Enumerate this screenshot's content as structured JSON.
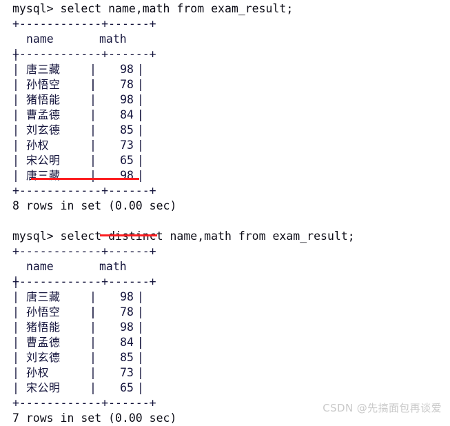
{
  "terminal": {
    "prompt": "mysql> ",
    "blocks": [
      {
        "id": "query-1",
        "command": "mysql> select name,math from exam_result;",
        "separator": "+------------+------+",
        "headers": {
          "name": "name",
          "math": "math"
        },
        "rows": [
          {
            "name": "唐三藏",
            "math": "98"
          },
          {
            "name": "孙悟空",
            "math": "78"
          },
          {
            "name": "猪悟能",
            "math": "98"
          },
          {
            "name": "曹孟德",
            "math": "84"
          },
          {
            "name": "刘玄德",
            "math": "85"
          },
          {
            "name": "孙权",
            "math": "73"
          },
          {
            "name": "宋公明",
            "math": "65"
          },
          {
            "name": "唐三藏",
            "math": "98"
          }
        ],
        "result": "8 rows in set (0.00 sec)"
      },
      {
        "id": "query-2",
        "command": "mysql> select distinct name,math from exam_result;",
        "separator": "+------------+------+",
        "headers": {
          "name": "name",
          "math": "math"
        },
        "rows": [
          {
            "name": "唐三藏",
            "math": "98"
          },
          {
            "name": "孙悟空",
            "math": "78"
          },
          {
            "name": "猪悟能",
            "math": "98"
          },
          {
            "name": "曹孟德",
            "math": "84"
          },
          {
            "name": "刘玄德",
            "math": "85"
          },
          {
            "name": "孙权",
            "math": "73"
          },
          {
            "name": "宋公明",
            "math": "65"
          }
        ],
        "result": "7 rows in set (0.00 sec)"
      }
    ],
    "glyphs": {
      "pipe": "|"
    },
    "annotations": [
      {
        "id": "underline-duplicate-row",
        "label": "duplicate row highlight",
        "color": "#fc1d20"
      },
      {
        "id": "underline-distinct-keyword",
        "label": "distinct",
        "color": "#fc1d20"
      }
    ]
  },
  "watermark": {
    "text": "CSDN @先搞面包再谈爱",
    "color": "#c9c9c9"
  }
}
